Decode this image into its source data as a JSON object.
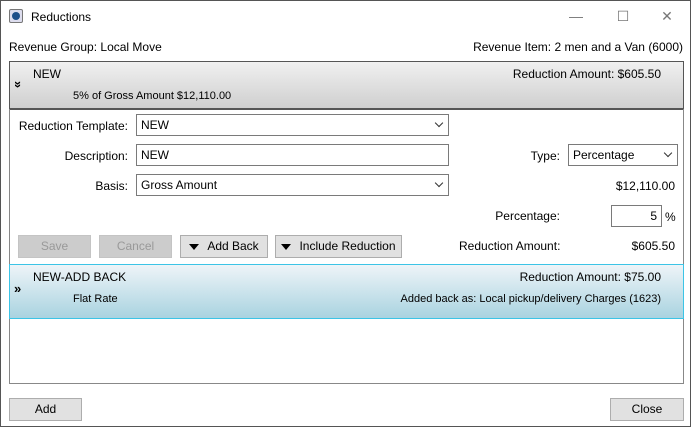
{
  "window": {
    "title": "Reductions",
    "minimize": "—",
    "maximize": "☐",
    "close": "✕"
  },
  "header": {
    "revenue_group": "Revenue Group: Local Move",
    "revenue_item": "Revenue Item: 2 men and a Van (6000)"
  },
  "reduction1": {
    "name": "NEW",
    "amount": "Reduction Amount: $605.50",
    "summary": "5% of Gross Amount $12,110.00",
    "toggle": "»"
  },
  "form": {
    "template_label": "Reduction Template:",
    "template_value": "NEW",
    "description_label": "Description:",
    "description_value": "NEW",
    "basis_label": "Basis:",
    "basis_value": "Gross Amount",
    "type_label": "Type:",
    "type_value": "Percentage",
    "basis_amount": "$12,110.00",
    "percentage_label": "Percentage:",
    "percentage_value": "5",
    "percent_sign": "%",
    "reduction_amount_label": "Reduction Amount:",
    "reduction_amount_value": "$605.50",
    "save": "Save",
    "cancel": "Cancel",
    "add_back": "Add Back",
    "include_reduction": "Include Reduction"
  },
  "reduction2": {
    "name": "NEW-ADD BACK",
    "amount": "Reduction Amount: $75.00",
    "summary": "Flat Rate",
    "added_back": "Added back as: Local pickup/delivery Charges (1623)",
    "toggle": "»"
  },
  "footer": {
    "add": "Add",
    "close": "Close"
  }
}
